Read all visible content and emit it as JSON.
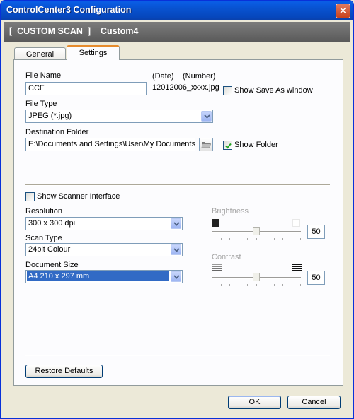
{
  "window": {
    "title": "ControlCenter3 Configuration",
    "close_glyph": "✕"
  },
  "header": {
    "text": "[  CUSTOM SCAN  ]    Custom4"
  },
  "tabs": [
    {
      "label": "General",
      "active": false
    },
    {
      "label": "Settings",
      "active": true
    }
  ],
  "file_name": {
    "label": "File Name",
    "value": "CCF",
    "date_label": "(Date)",
    "number_label": "(Number)",
    "suffix": "12012006_xxxx.jpg",
    "show_save_as_label": "Show Save As window",
    "show_save_as_checked": false
  },
  "file_type": {
    "label": "File Type",
    "selected": "JPEG (*.jpg)"
  },
  "destination": {
    "label": "Destination Folder",
    "value": "E:\\Documents and Settings\\User\\My Documents\\My",
    "browse_icon": "folder-icon",
    "show_folder_label": "Show Folder",
    "show_folder_checked": true
  },
  "scanner_interface": {
    "label": "Show Scanner Interface",
    "checked": false
  },
  "resolution": {
    "label": "Resolution",
    "selected": "300 x 300 dpi"
  },
  "scan_type": {
    "label": "Scan Type",
    "selected": "24bit Colour"
  },
  "document_size": {
    "label": "Document Size",
    "selected": "A4 210 x 297 mm"
  },
  "brightness": {
    "label": "Brightness",
    "value": "50",
    "level": 50
  },
  "contrast": {
    "label": "Contrast",
    "value": "50",
    "level": 50
  },
  "buttons": {
    "restore": "Restore Defaults",
    "ok": "OK",
    "cancel": "Cancel"
  },
  "colors": {
    "title_bar": "#0852d0",
    "header_band": "#6b6b6b",
    "selection": "#316ac5",
    "dialog_bg": "#ece9d8"
  }
}
